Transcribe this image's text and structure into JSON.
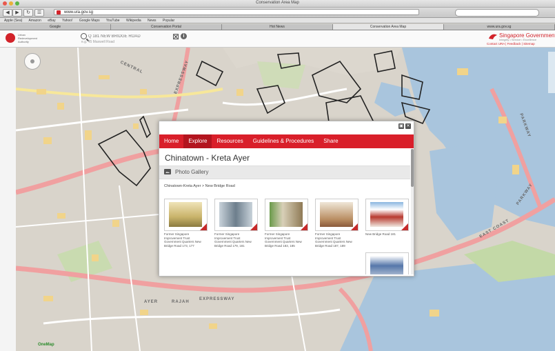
{
  "window": {
    "title": "Conservation Area Map"
  },
  "browser": {
    "url": "www.ura.gov.sg",
    "back_label": "◀",
    "forward_label": "▶",
    "reload_label": "↻",
    "bookmarks": [
      "Apple (Sea)",
      "Amazon",
      "eBay",
      "Yahoo!",
      "Google Maps",
      "YouTube",
      "Wikipedia",
      "News",
      "Popular"
    ],
    "tabs": [
      {
        "label": "Google",
        "active": false
      },
      {
        "label": "Conservation Portal",
        "active": false
      },
      {
        "label": "Hot News",
        "active": false
      },
      {
        "label": "Conservation Area Map",
        "active": true
      },
      {
        "label": "www.ura.gov.sg",
        "active": false
      }
    ]
  },
  "site": {
    "org_name": "Urban Redevelopment Authority",
    "search_placeholder": "Q 181 NEW BRIDGE ROAD",
    "search_example": "e.g. 45 Maxwell Road",
    "clear_icon": "⊠",
    "info_icon": "i",
    "gov_title": "Singapore Government",
    "gov_tagline": "Integrity • Service • Excellence",
    "gov_links": "Contact URA | Feedback | Sitemap"
  },
  "map": {
    "labels": [
      "CENTRAL",
      "EXPRESSWAY",
      "AYER",
      "RAJAH",
      "EXPRESSWAY",
      "EAST COAST",
      "PARKWAY",
      "PARKWAY"
    ],
    "credits": "OneMap"
  },
  "dialog": {
    "controls": [
      "▣",
      "✕"
    ],
    "nav": [
      {
        "label": "Home",
        "active": false
      },
      {
        "label": "Explore",
        "active": true
      },
      {
        "label": "Resources",
        "active": false
      },
      {
        "label": "Guidelines & Procedures",
        "active": false
      },
      {
        "label": "Share",
        "active": false
      }
    ],
    "title": "Chinatown - Kreta Ayer",
    "section_label": "Photo Gallery",
    "breadcrumb": "Chinatown-Kreta Ayer > New Bridge Road",
    "thumbnails": [
      {
        "caption": "Former Singapore Improvement Trust Government Quarters New Bridge Road 173, 177",
        "tone": "#c9b36a"
      },
      {
        "caption": "Former Singapore Improvement Trust Government Quarters New Bridge Road 179, 181",
        "tone": "#6d7e8c"
      },
      {
        "caption": "Former Singapore Improvement Trust Government Quarters New Bridge Road 183, 185",
        "tone": "#8f7a55"
      },
      {
        "caption": "Former Singapore Improvement Trust Government Quarters New Bridge Road 187, 189",
        "tone": "#b98d62"
      },
      {
        "caption": "New Bridge Road 181",
        "tone": "#b83a30"
      },
      {
        "caption": "",
        "tone": "#5577aa"
      }
    ]
  },
  "colors": {
    "accent": "#d91f2a",
    "water": "#a9c5dd",
    "road": "#f2a9a9"
  }
}
